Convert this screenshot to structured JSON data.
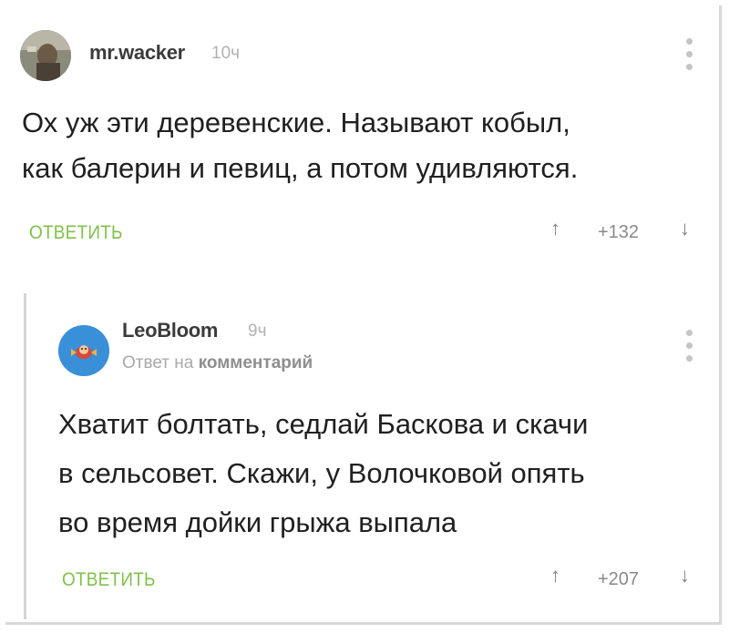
{
  "comments": [
    {
      "username": "mr.wacker",
      "time": "10ч",
      "lines": [
        "Ох уж эти деревенские. Называют кобыл,",
        "как балерин и певиц, а потом удивляются."
      ],
      "reply_label": "ОТВЕТИТЬ",
      "rating": "+132",
      "upvote_icon": "↑",
      "downvote_icon": "↓"
    },
    {
      "username": "LeoBloom",
      "time": "9ч",
      "reply_prefix": "Ответ на",
      "reply_target": "комментарий",
      "lines": [
        "Хватит болтать, седлай Баскова и скачи",
        "в сельсовет. Скажи, у Волочковой опять",
        "во время дойки грыжа выпала"
      ],
      "reply_label": "ОТВЕТИТЬ",
      "rating": "+207",
      "upvote_icon": "↑",
      "downvote_icon": "↓"
    }
  ],
  "colors": {
    "accent_green": "#7fc14a",
    "muted_gray": "#b2b2b2",
    "text": "#202020"
  }
}
